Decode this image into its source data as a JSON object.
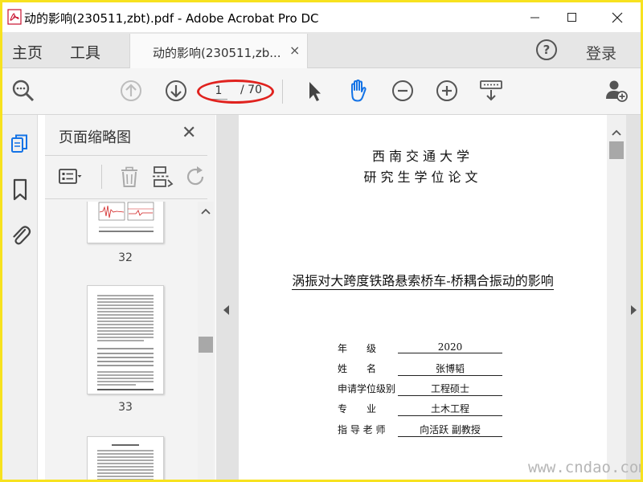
{
  "window": {
    "title": "动的影响(230511,zbt).pdf - Adobe Acrobat Pro DC",
    "minimize_icon": "minimize-icon",
    "maximize_icon": "maximize-icon",
    "close_icon": "close-icon"
  },
  "tabs": {
    "home": "主页",
    "tools": "工具",
    "document": "动的影响(230511,zb...",
    "document_close": "×",
    "help": "?",
    "login": "登录"
  },
  "toolbar": {
    "current_page": "1",
    "total_pages": "/ 70",
    "icons": [
      "zoom-search-icon",
      "page-up-icon",
      "page-down-icon",
      "select-arrow-icon",
      "hand-tool-icon",
      "zoom-out-icon",
      "zoom-in-icon",
      "keyboard-scroll-icon",
      "share-user-icon"
    ],
    "accent_color": "#1473e6",
    "highlight_color": "#e0221e"
  },
  "rail": {
    "icons": [
      "page-thumbnails-icon",
      "bookmark-icon",
      "attachment-icon"
    ]
  },
  "thumbnail_panel": {
    "title": "页面缩略图",
    "close": "✕",
    "pages": [
      {
        "number": "32"
      },
      {
        "number": "33"
      }
    ]
  },
  "document": {
    "university": "西南交通大学",
    "degree_type": "研究生学位论文",
    "thesis_title": "涡振对大跨度铁路悬索桥车-桥耦合振动的影响",
    "fields": [
      {
        "label": "年　　级",
        "value": "2020"
      },
      {
        "label": "姓　　名",
        "value": "张博韬"
      },
      {
        "label": "申请学位级别",
        "value": "工程硕士"
      },
      {
        "label": "专　　业",
        "value": "土木工程"
      },
      {
        "label": "指 导 老 师",
        "value": "向活跃 副教授"
      }
    ]
  },
  "watermark": "www.cndao.com",
  "frame_color": "#f7e21f"
}
